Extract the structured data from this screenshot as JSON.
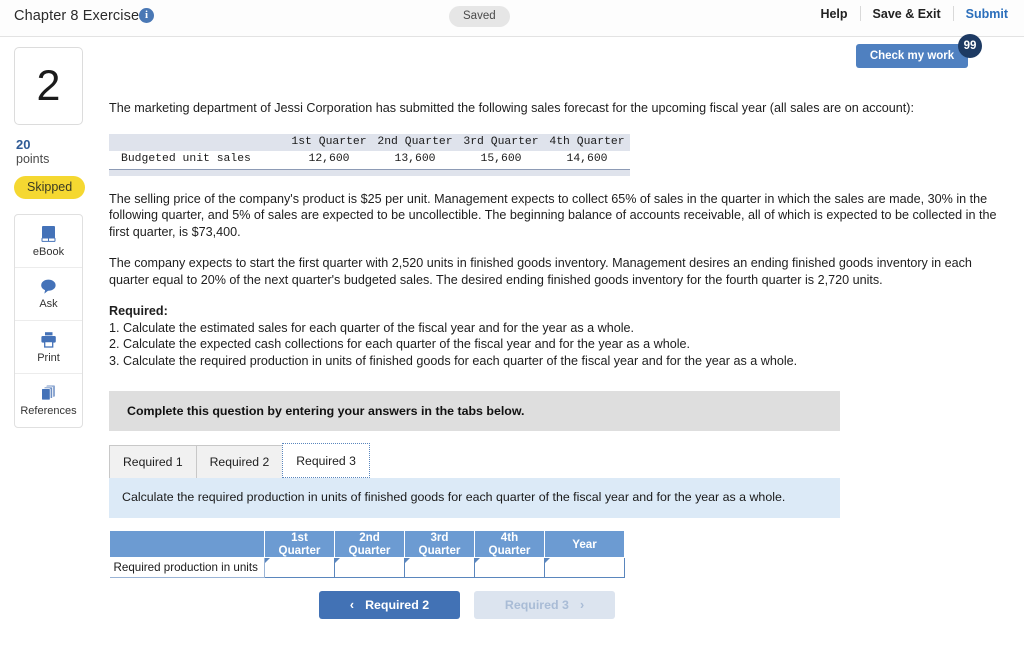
{
  "header": {
    "title": "Chapter 8 Exercises",
    "info_icon": "info-icon",
    "saved_label": "Saved",
    "help_label": "Help",
    "save_exit_label": "Save & Exit",
    "submit_label": "Submit",
    "check_my_work_label": "Check my work",
    "check_my_work_badge": "99",
    "accent_blue": "#4f80c0",
    "badge_navy": "#1d3a63"
  },
  "sidebar": {
    "question_number": "2",
    "points_value": "20",
    "points_label": "points",
    "status_badge": "Skipped",
    "status_color": "#f5d831",
    "tools": [
      {
        "icon": "book-icon",
        "label": "eBook"
      },
      {
        "icon": "chat-bubble-icon",
        "label": "Ask"
      },
      {
        "icon": "printer-icon",
        "label": "Print"
      },
      {
        "icon": "copy-pages-icon",
        "label": "References"
      }
    ]
  },
  "main": {
    "intro_paragraph": "The marketing department of Jessi Corporation has submitted the following sales forecast for the upcoming fiscal year (all sales are on account):",
    "paragraph_2": "The selling price of the company's product is $25 per unit. Management expects to collect 65% of sales in the quarter in which the sales are made, 30% in the following quarter, and 5% of sales are expected to be uncollectible. The beginning balance of accounts receivable, all of which is expected to be collected in the first quarter, is $73,400.",
    "paragraph_3": "The company expects to start the first quarter with 2,520 units in finished goods inventory. Management desires an ending finished goods inventory in each quarter equal to 20% of the next quarter's budgeted sales. The desired ending finished goods inventory for the fourth quarter is 2,720 units.",
    "required_heading": "Required:",
    "required_items": [
      "1. Calculate the estimated sales for each quarter of the fiscal year and for the year as a whole.",
      "2. Calculate the expected cash collections for each quarter of the fiscal year and for the year as a whole.",
      "3. Calculate the required production in units of finished goods for each quarter of the fiscal year and for the year as a whole."
    ],
    "band_text": "Complete this question by entering your answers in the tabs below."
  },
  "budget_table": {
    "columns": [
      "1st Quarter",
      "2nd Quarter",
      "3rd Quarter",
      "4th Quarter"
    ],
    "row_label": "Budgeted unit sales",
    "values": [
      "12,600",
      "13,600",
      "15,600",
      "14,600"
    ]
  },
  "tabs": {
    "items": [
      {
        "label": "Required 1",
        "active": false
      },
      {
        "label": "Required 2",
        "active": false
      },
      {
        "label": "Required 3",
        "active": true
      }
    ],
    "panel_text": "Calculate the required production in units of finished goods for each quarter of the fiscal year and for the year as a whole."
  },
  "answer_grid": {
    "corner_header": "",
    "columns": [
      "1st Quarter",
      "2nd Quarter",
      "3rd Quarter",
      "4th Quarter",
      "Year"
    ],
    "row_label": "Required production in units",
    "cells": [
      "",
      "",
      "",
      "",
      ""
    ],
    "header_color": "#6c9bd2"
  },
  "footer_nav": {
    "prev_label": "Required 2",
    "prev_chevron": "‹",
    "next_label": "Required 3",
    "next_chevron": "›"
  }
}
